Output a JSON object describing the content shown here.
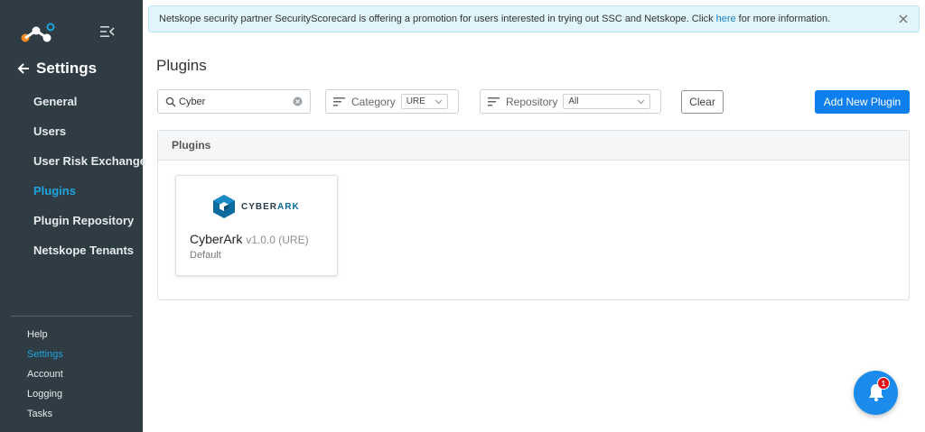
{
  "banner": {
    "text_before": "Netskope security partner SecurityScorecard is offering a promotion for users interested in trying out SSC and Netskope. Click",
    "link": "here",
    "text_after": "for more information."
  },
  "sidebar": {
    "title": "Settings",
    "items": [
      {
        "label": "General",
        "active": false
      },
      {
        "label": "Users",
        "active": false
      },
      {
        "label": "User Risk Exchange",
        "active": false
      },
      {
        "label": "Plugins",
        "active": true
      },
      {
        "label": "Plugin Repository",
        "active": false
      },
      {
        "label": "Netskope Tenants",
        "active": false
      }
    ],
    "bottom_items": [
      {
        "label": "Help",
        "active": false
      },
      {
        "label": "Settings",
        "active": true
      },
      {
        "label": "Account",
        "active": false
      },
      {
        "label": "Logging",
        "active": false
      },
      {
        "label": "Tasks",
        "active": false
      }
    ]
  },
  "page": {
    "title": "Plugins"
  },
  "filters": {
    "search_value": "Cyber",
    "category_label": "Category",
    "category_value": "URE",
    "repository_label": "Repository",
    "repository_value": "All",
    "clear_label": "Clear",
    "add_label": "Add New Plugin"
  },
  "panel": {
    "header": "Plugins",
    "cards": [
      {
        "brand_prefix": "CYBER",
        "brand_suffix": "ARK",
        "name": "CyberArk",
        "version": "v1.0.0 (URE)",
        "subtitle": "Default"
      }
    ]
  },
  "notifications": {
    "count": "1"
  },
  "colors": {
    "sidebar_bg": "#2f3c43",
    "accent": "#1fa4de",
    "primary_button": "#0d7fef",
    "banner_bg": "#dff5fb",
    "badge": "#e0131a"
  }
}
